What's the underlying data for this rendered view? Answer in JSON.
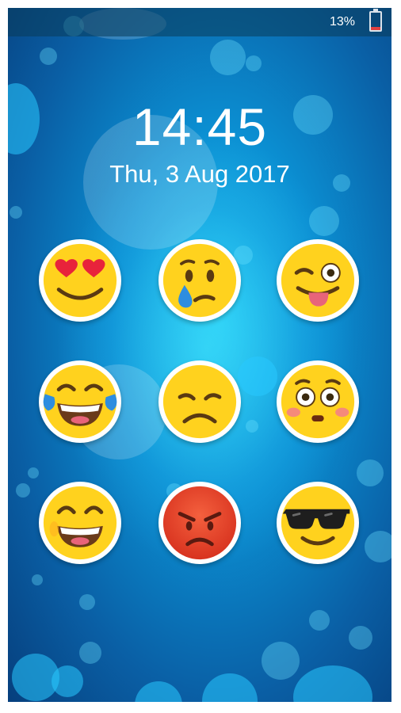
{
  "status_bar": {
    "battery_percent": "13%",
    "battery_icon": "battery-low-icon",
    "battery_color": "#e04040"
  },
  "lock_screen": {
    "time": "14:45",
    "date": "Thu, 3 Aug 2017"
  },
  "emoji_pattern": [
    {
      "name": "heart-eyes-emoji"
    },
    {
      "name": "crying-tear-emoji"
    },
    {
      "name": "winking-tongue-emoji"
    },
    {
      "name": "tears-of-joy-emoji"
    },
    {
      "name": "sad-face-emoji"
    },
    {
      "name": "flushed-face-emoji"
    },
    {
      "name": "grinning-squint-emoji"
    },
    {
      "name": "angry-red-emoji"
    },
    {
      "name": "sunglasses-emoji"
    }
  ],
  "colors": {
    "emoji_yellow": "#ffd21e",
    "emoji_angry": "#ee5a3a",
    "background_blue": "#0b8fd2"
  }
}
